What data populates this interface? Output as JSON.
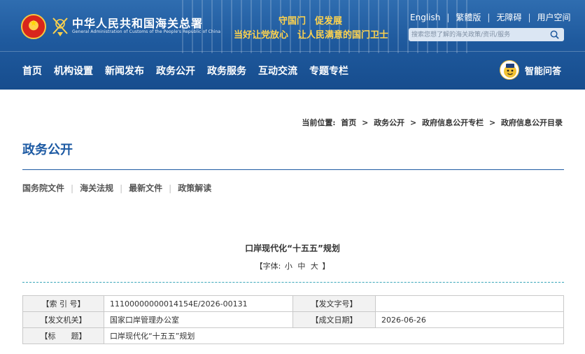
{
  "header": {
    "site_title": "中华人民共和国海关总署",
    "site_subtitle": "General Administration of Customs of the People's Republic of China",
    "slogan_line1": "守国门　促发展",
    "slogan_line2": "当好让党放心　让人民满意的国门卫士",
    "top_links": [
      "English",
      "繁體版",
      "无障碍",
      "用户空间"
    ],
    "search_placeholder": "搜索您想了解的海关政策/资讯/服务",
    "nav": [
      "首页",
      "机构设置",
      "新闻发布",
      "政务公开",
      "政务服务",
      "互动交流",
      "专题专栏"
    ],
    "assistant_label": "智能问答"
  },
  "breadcrumb": {
    "prefix": "当前位置:",
    "items": [
      "首页",
      "政务公开",
      "政府信息公开专栏",
      "政府信息公开目录"
    ],
    "separator": ">"
  },
  "section_title": "政务公开",
  "subnav": [
    "国务院文件",
    "海关法规",
    "最新文件",
    "政策解读"
  ],
  "document": {
    "title": "口岸现代化“十五五”规划",
    "font_label": "【字体:",
    "font_options": [
      "小",
      "中",
      "大"
    ],
    "font_close": "】"
  },
  "meta": {
    "index_label": "【索 引 号】",
    "index_value": "11100000000014154E/2026-00131",
    "doc_no_label": "【发文字号】",
    "doc_no_value": "",
    "issuer_label": "【发文机关】",
    "issuer_value": "国家口岸管理办公室",
    "date_label": "【成文日期】",
    "date_value": "2026-06-26",
    "subject_label": "【标　　题】",
    "subject_value": "口岸现代化“十五五”规划"
  },
  "colors": {
    "header_blue": "#1f5a9e",
    "accent_blue": "#1d5aa3",
    "slogan_gold": "#ffd34d",
    "dashed_teal": "#3aa6b9"
  }
}
